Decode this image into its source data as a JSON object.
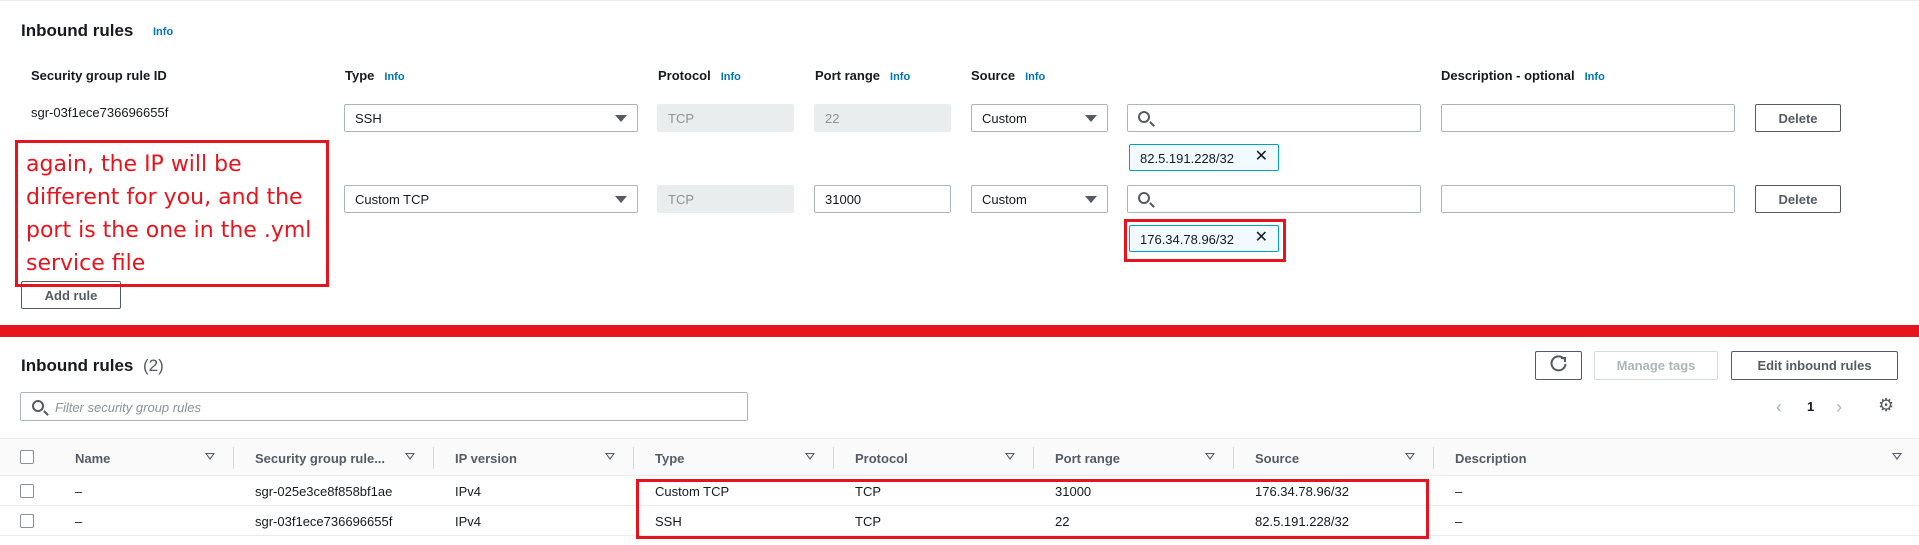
{
  "editor": {
    "title": "Inbound rules",
    "title_info": "Info",
    "columns": {
      "rule_id": "Security group rule ID",
      "type": "Type",
      "protocol": "Protocol",
      "port_range": "Port range",
      "source": "Source",
      "description": "Description - optional",
      "info": "Info"
    },
    "rules": [
      {
        "rule_id": "sgr-03f1ece736696655f",
        "type": "SSH",
        "protocol": "TCP",
        "port": "22",
        "source": "Custom",
        "search_value": "",
        "cidr": "82.5.191.228/32",
        "description": "",
        "delete_label": "Delete"
      },
      {
        "rule_id": "",
        "type": "Custom TCP",
        "protocol": "TCP",
        "port": "31000",
        "source": "Custom",
        "search_value": "",
        "cidr": "176.34.78.96/32",
        "description": "",
        "delete_label": "Delete"
      }
    ],
    "add_rule_label": "Add rule"
  },
  "annotation": {
    "text": "again, the IP will be different for you, and the port is the one in the .yml service file",
    "color": "#e8141d"
  },
  "table": {
    "title": "Inbound rules",
    "count": "(2)",
    "refresh_icon": "refresh-icon",
    "manage_tags_label": "Manage tags",
    "edit_label": "Edit inbound rules",
    "filter_placeholder": "Filter security group rules",
    "page": "1",
    "headers": {
      "name": "Name",
      "rule_id": "Security group rule...",
      "ip_version": "IP version",
      "type": "Type",
      "protocol": "Protocol",
      "port_range": "Port range",
      "source": "Source",
      "description": "Description"
    },
    "rows": [
      {
        "name": "–",
        "rule_id": "sgr-025e3ce8f858bf1ae",
        "ip_version": "IPv4",
        "type": "Custom TCP",
        "protocol": "TCP",
        "port_range": "31000",
        "source": "176.34.78.96/32",
        "description": "–"
      },
      {
        "name": "–",
        "rule_id": "sgr-03f1ece736696655f",
        "ip_version": "IPv4",
        "type": "SSH",
        "protocol": "TCP",
        "port_range": "22",
        "source": "82.5.191.228/32",
        "description": "–"
      }
    ]
  },
  "colors": {
    "accent": "#0073bb",
    "annotation_red": "#e8141d",
    "token_border": "#00a1c9"
  }
}
